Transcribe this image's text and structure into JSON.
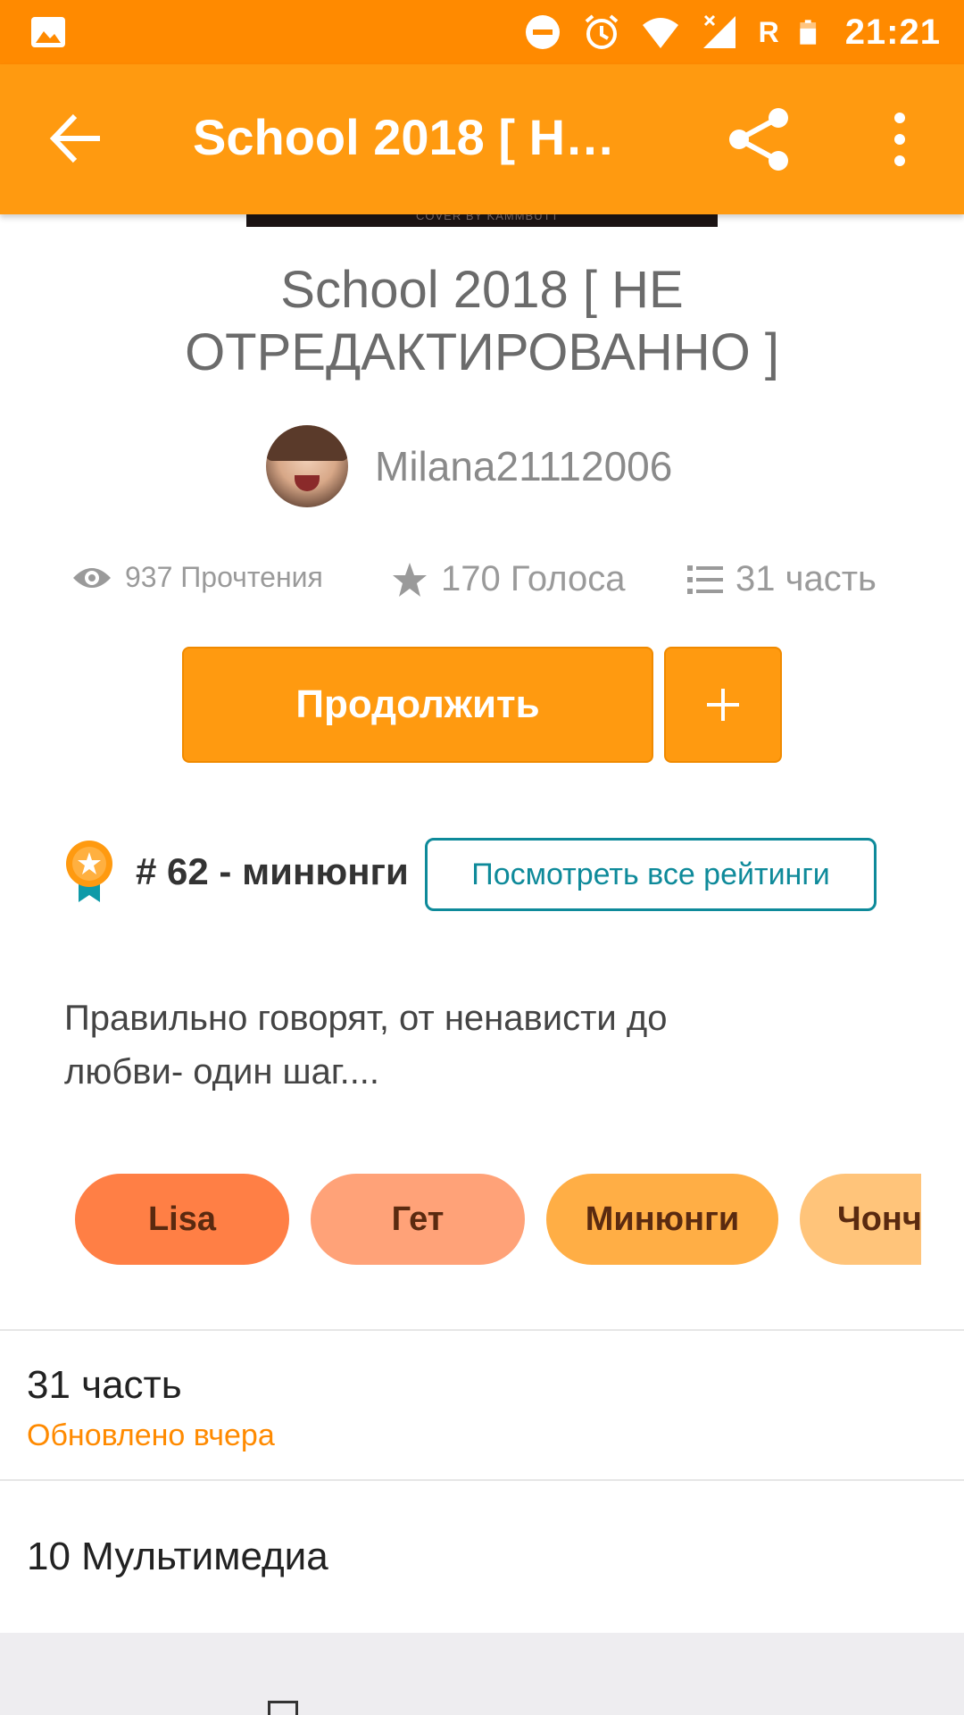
{
  "status_bar": {
    "time": "21:21",
    "roaming": "R",
    "icons": [
      "image-icon",
      "dnd-icon",
      "alarm-icon",
      "wifi-icon",
      "signal-icon",
      "battery-icon"
    ],
    "background": "#ff8a00"
  },
  "app_bar": {
    "title": "School 2018 [ НЕ ОТРЕДАКТИРОВАННО ]",
    "icons": [
      "back-arrow-icon",
      "share-icon",
      "more-vert-icon"
    ],
    "background": "#ff9a10"
  },
  "cover": {
    "caption": "COVER BY KAMMBUTT"
  },
  "story": {
    "title": "School 2018 [ НЕ ОТРЕДАКТИРОВАННО ]",
    "author": "Milana21112006"
  },
  "stats": {
    "reads": "937 Прочтения",
    "votes": "170 Голоса",
    "parts": "31 часть",
    "icons": [
      "eye-icon",
      "star-icon",
      "list-icon"
    ]
  },
  "actions": {
    "continue_label": "Продолжить",
    "add_label": "+",
    "accent": "#ff9a10"
  },
  "ranking": {
    "label": "# 62 - минюнги",
    "button_label": "Посмотреть все рейтинги",
    "button_color": "#0e8a9a"
  },
  "description": "Правильно говорят, от ненависти до любви- один шаг....",
  "tags": [
    "Lisa",
    "Гет",
    "Минюнги",
    "Чонч"
  ],
  "parts_section": {
    "title": "31 часть",
    "updated": "Обновлено вчера"
  },
  "media_section": {
    "title": "10 Мультимедиа"
  }
}
